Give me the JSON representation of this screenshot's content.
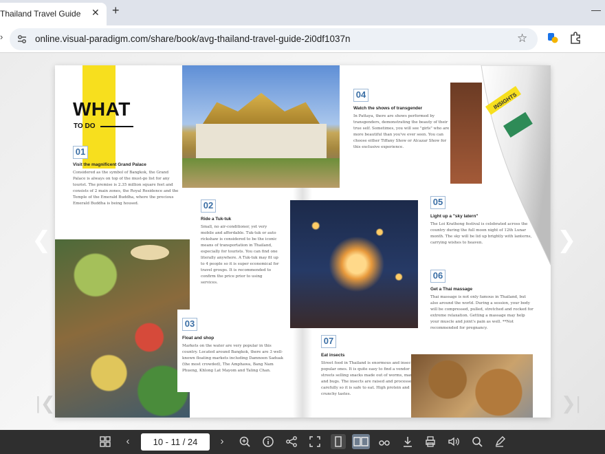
{
  "browser": {
    "tab_title": "Thailand Travel Guide",
    "url": "online.visual-paradigm.com/share/book/avg-thailand-travel-guide-2i0df1037n"
  },
  "book": {
    "heading": "WHAT",
    "subheading": "TO DO",
    "items": [
      {
        "num": "01",
        "title": "Visit the magnificent Grand Palace",
        "text": "Considered as the symbol of Bangkok, the Grand Palace is always on top of the must-go list for any tourist. The premise is 2.35 million square feet and consists of 2 main zones, the Royal Residence and the Temple of the Emerald Buddha, where the precious Emerald Buddha is being housed."
      },
      {
        "num": "02",
        "title": "Ride a Tuk-tuk",
        "text": "Small, no air-conditioner, yet very mobile and affordable. Tuk-tuk or auto rickshaw is considered to be the iconic means of transportation in Thailand, especially for tourists. You can find one literally anywhere. A Tuk-tuk may fit up to 4 people so it is super economical for travel groups. It is recommended to confirm the price prior to using services."
      },
      {
        "num": "03",
        "title": "Float and shop",
        "text": "Markets on the water are very popular in this country. Located around Bangkok, there are 3 well-known floating markets including Damnoen Saduak (the most crowded), The Amphawa, Bang Nam Phueng, Khlong Lat Mayom and Taling Chan."
      },
      {
        "num": "04",
        "title": "Watch the shows of transgender",
        "text": "In Pattaya, there are shows performed by transgenders, demonstrating the beauty of their true self. Sometimes, you will see \"girls\" who are more beautiful than you've ever seen. You can choose either Tiffany Show or Alcazar Show for this exclusive experience."
      },
      {
        "num": "05",
        "title": "Light up a \"sky latern\"",
        "text": "The Loi Krathong festival is celebrated across the country during the full moon night of 12th Lunar month. The sky will be lid up brightly with lanterns, carrying wishes to heaven."
      },
      {
        "num": "06",
        "title": "Get a Thai massage",
        "text": "Thai massage is not only famous in Thailand, but also around the world. During a session, your body will be compressed, pulled, stretched and rocked for extreme relaxation. Getting a massage may help your muscle and joint's pain as well. **Not recommended for pregnancy."
      },
      {
        "num": "07",
        "title": "Eat insects",
        "text": "Street food in Thailand is enormous and insects are popular ones. It is quite easy to find a vendor on streets selling snacks made out of worms, mantis, and bugs. The insects are raised and processed carefully so it is safe to eat. High protein and crunchy tastes."
      }
    ],
    "curl_badge": "INSIGHTS"
  },
  "toolbar": {
    "page_indicator": "10 - 11 / 24"
  },
  "colors": {
    "accent_yellow": "#f7df1e",
    "number_blue": "#3a6ea5",
    "toolbar_bg": "#2f2f2f"
  }
}
